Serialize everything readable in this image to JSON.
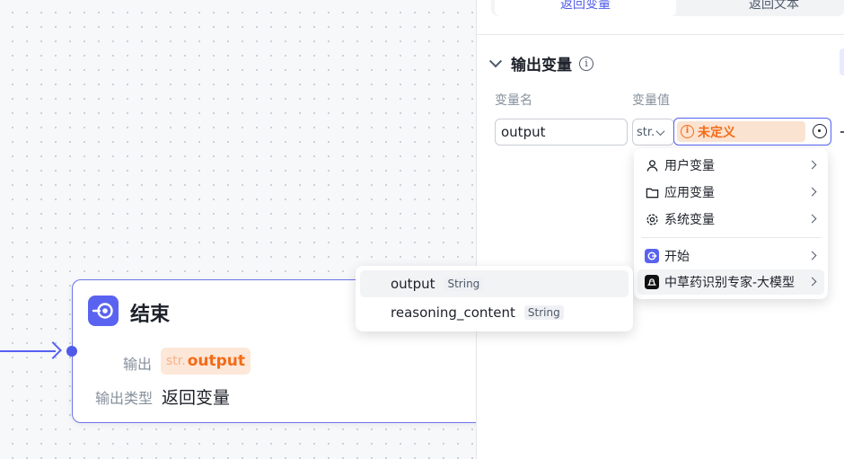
{
  "canvas": {
    "end_node": {
      "title": "结束",
      "output_label": "输出",
      "output_tag_prefix": "str.",
      "output_tag_name": "output",
      "output_type_label": "输出类型",
      "output_type_value": "返回变量"
    }
  },
  "panel": {
    "tabs": [
      {
        "label": "返回变量",
        "active": true
      },
      {
        "label": "返回文本",
        "active": false
      }
    ],
    "section_title": "输出变量",
    "columns": {
      "name": "变量名",
      "value": "变量值"
    },
    "row": {
      "name_value": "output",
      "type_value": "str.",
      "value_tag": "未定义"
    }
  },
  "variable_menu": {
    "items": [
      {
        "label": "用户变量",
        "icon": "user-icon"
      },
      {
        "label": "应用变量",
        "icon": "folder-icon"
      },
      {
        "label": "系统变量",
        "icon": "gear-icon"
      },
      {
        "label": "开始",
        "icon": "start-node-icon"
      },
      {
        "label": "中草药识别专家-大模型",
        "icon": "llm-node-icon"
      }
    ]
  },
  "output_submenu": {
    "items": [
      {
        "name": "output",
        "type": "String"
      },
      {
        "name": "reasoning_content",
        "type": "String"
      }
    ]
  },
  "colors": {
    "accent": "#5561f1",
    "warning": "#f56b16",
    "warning_bg": "#fbe3d1"
  }
}
